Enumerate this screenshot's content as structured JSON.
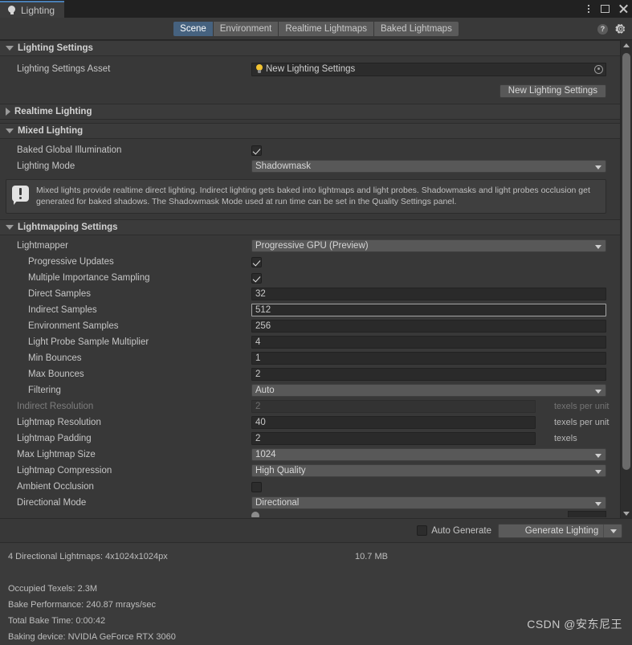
{
  "window": {
    "tab_label": "Lighting",
    "tab_icon": "lightbulb-icon",
    "controls": [
      "kebab-menu-icon",
      "maximize-icon",
      "close-icon"
    ]
  },
  "toolbar": {
    "tabs": [
      {
        "label": "Scene",
        "active": true
      },
      {
        "label": "Environment",
        "active": false
      },
      {
        "label": "Realtime Lightmaps",
        "active": false
      },
      {
        "label": "Baked Lightmaps",
        "active": false
      }
    ],
    "help_icon": "help-question-icon",
    "settings_icon": "gear-icon"
  },
  "sections": {
    "lighting_settings": {
      "title": "Lighting Settings",
      "expanded": true,
      "asset_label": "Lighting Settings Asset",
      "asset_value": "New Lighting Settings",
      "new_button": "New Lighting Settings"
    },
    "realtime_lighting": {
      "title": "Realtime Lighting",
      "expanded": false
    },
    "mixed_lighting": {
      "title": "Mixed Lighting",
      "expanded": true,
      "baked_gi_label": "Baked Global Illumination",
      "baked_gi_checked": true,
      "lighting_mode_label": "Lighting Mode",
      "lighting_mode_value": "Shadowmask",
      "info_text": "Mixed lights provide realtime direct lighting. Indirect lighting gets baked into lightmaps and light probes. Shadowmasks and light probes occlusion get generated for baked shadows. The Shadowmask Mode used at run time can be set in the Quality Settings panel."
    },
    "lightmapping_settings": {
      "title": "Lightmapping Settings",
      "expanded": true,
      "rows": [
        {
          "label": "Lightmapper",
          "type": "dropdown",
          "value": "Progressive GPU (Preview)",
          "indent": false
        },
        {
          "label": "Progressive Updates",
          "type": "checkbox",
          "value": true,
          "indent": true
        },
        {
          "label": "Multiple Importance Sampling",
          "type": "checkbox",
          "value": true,
          "indent": true
        },
        {
          "label": "Direct Samples",
          "type": "text",
          "value": "32",
          "indent": true
        },
        {
          "label": "Indirect Samples",
          "type": "text",
          "value": "512",
          "indent": true,
          "focused": true
        },
        {
          "label": "Environment Samples",
          "type": "text",
          "value": "256",
          "indent": true
        },
        {
          "label": "Light Probe Sample Multiplier",
          "type": "text",
          "value": "4",
          "indent": true
        },
        {
          "label": "Min Bounces",
          "type": "text",
          "value": "1",
          "indent": true
        },
        {
          "label": "Max Bounces",
          "type": "text",
          "value": "2",
          "indent": true
        },
        {
          "label": "Filtering",
          "type": "dropdown",
          "value": "Auto",
          "indent": true
        },
        {
          "label": "Indirect Resolution",
          "type": "text",
          "value": "2",
          "indent": false,
          "disabled": true,
          "unit": "texels per unit"
        },
        {
          "label": "Lightmap Resolution",
          "type": "text",
          "value": "40",
          "indent": false,
          "unit": "texels per unit"
        },
        {
          "label": "Lightmap Padding",
          "type": "text",
          "value": "2",
          "indent": false,
          "unit": "texels"
        },
        {
          "label": "Max Lightmap Size",
          "type": "dropdown",
          "value": "1024",
          "indent": false
        },
        {
          "label": "Lightmap Compression",
          "type": "dropdown",
          "value": "High Quality",
          "indent": false
        },
        {
          "label": "Ambient Occlusion",
          "type": "checkbox",
          "value": false,
          "indent": false
        },
        {
          "label": "Directional Mode",
          "type": "dropdown",
          "value": "Directional",
          "indent": false
        }
      ]
    }
  },
  "bottom_bar": {
    "auto_generate_label": "Auto Generate",
    "auto_generate_checked": false,
    "generate_button": "Generate Lighting"
  },
  "stats": {
    "lightmaps_line": "4 Directional Lightmaps: 4x1024x1024px",
    "lightmaps_size": "10.7 MB",
    "occupied_texels": "Occupied Texels: 2.3M",
    "bake_performance": "Bake Performance: 240.87 mrays/sec",
    "total_bake_time": "Total Bake Time: 0:00:42",
    "baking_device": "Baking device: NVIDIA GeForce RTX 3060"
  },
  "watermark": "CSDN @安东尼王",
  "colors": {
    "window_bg": "#383838",
    "titlebar_bg": "#212121",
    "tab_accent": "#4a7fb5",
    "active_tab_bg": "#46627f",
    "section_header_bg": "#3b3b3b",
    "field_bg": "#2a2a2a",
    "dropdown_bg": "#585858",
    "asset_icon": "#f2c331"
  }
}
